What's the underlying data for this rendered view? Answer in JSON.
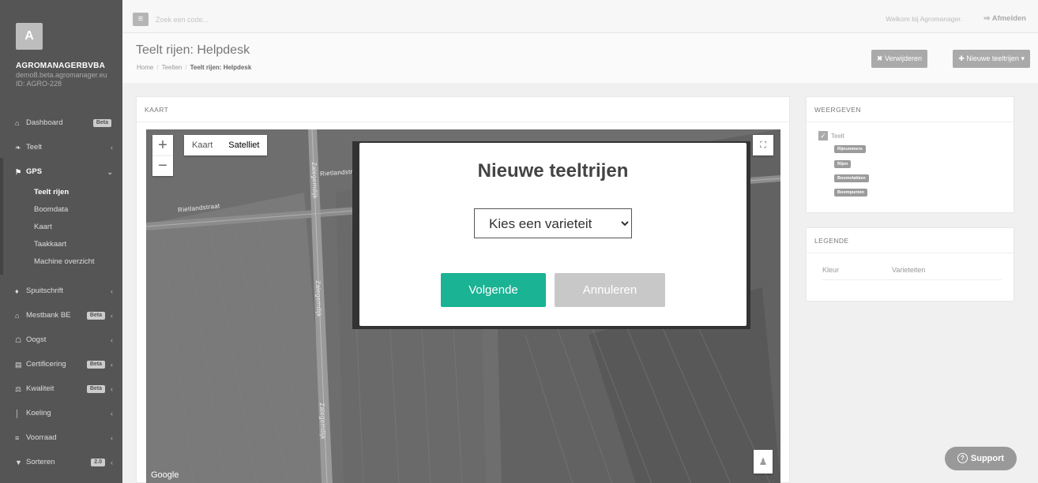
{
  "sidebar": {
    "logo_letter": "A",
    "company": "AGROMANAGERBVBA",
    "email": "demo8.beta.agromanager.eu",
    "id": "ID: AGRO-228",
    "items": [
      {
        "label": "Dashboard",
        "icon": "home-icon",
        "glyph": "⌂",
        "badge": "Beta"
      },
      {
        "label": "Teelt",
        "icon": "leaf-icon",
        "glyph": "❧"
      },
      {
        "label": "GPS",
        "icon": "map-marker-icon",
        "glyph": "⚑"
      },
      {
        "label": "Spuitschrift",
        "icon": "drop-icon",
        "glyph": "♦"
      },
      {
        "label": "Mestbank BE",
        "icon": "bank-icon",
        "glyph": "⌂",
        "badge": "Beta"
      },
      {
        "label": "Oogst",
        "icon": "basket-icon",
        "glyph": "☖"
      },
      {
        "label": "Certificering",
        "icon": "book-icon",
        "glyph": "▤",
        "badge": "Beta"
      },
      {
        "label": "Kwaliteit",
        "icon": "balance-icon",
        "glyph": "⚖",
        "badge": "Beta"
      },
      {
        "label": "Koeling",
        "icon": "thermometer-icon",
        "glyph": "│"
      },
      {
        "label": "Voorraad",
        "icon": "list-icon",
        "glyph": "≡"
      },
      {
        "label": "Sorteren",
        "icon": "filter-icon",
        "glyph": "▼",
        "badge": "2.0"
      }
    ],
    "gps_sub": [
      "Teelt rijen",
      "Boomdata",
      "Kaart",
      "Taakkaart",
      "Machine overzicht"
    ]
  },
  "topbar": {
    "menu_glyph": "≡",
    "search_placeholder": "Zoek een code...",
    "welcome": "Welkom bij Agromanager.",
    "logout": "Afmelden"
  },
  "header": {
    "title": "Teelt rijen: Helpdesk",
    "breadcrumb": [
      "Home",
      "Teelten",
      "Teelt rijen: Helpdesk"
    ],
    "delete_label": "Verwijderen",
    "new_label": "Nieuwe teeltrijen"
  },
  "map_panel": {
    "title": "KAART",
    "maptype": [
      "Kaart",
      "Satelliet"
    ],
    "zoom_in": "+",
    "zoom_out": "−",
    "google": "Google",
    "roads": [
      "Rietlandstraat",
      "Zalegemdijk",
      "Rietlandstraat",
      "Zalegemdijk",
      "Zalegemdijk"
    ]
  },
  "modal": {
    "title": "Nieuwe teeltrijen",
    "select_value": "Kies een varieteit",
    "next_label": "Volgende",
    "cancel_label": "Annuleren"
  },
  "view_panel": {
    "title": "WEERGEVEN",
    "root": "Teelt",
    "tags": [
      "Rijnummers",
      "Rijen",
      "Boomvlakken",
      "Boompunten"
    ]
  },
  "legend_panel": {
    "title": "LEGENDE",
    "col_color": "Kleur",
    "col_variety": "Varieteiten"
  },
  "support_label": "Support",
  "colors": {
    "sidebar": "#555555",
    "accent_green": "#1ab394",
    "button_grey": "#aaaaaa"
  }
}
